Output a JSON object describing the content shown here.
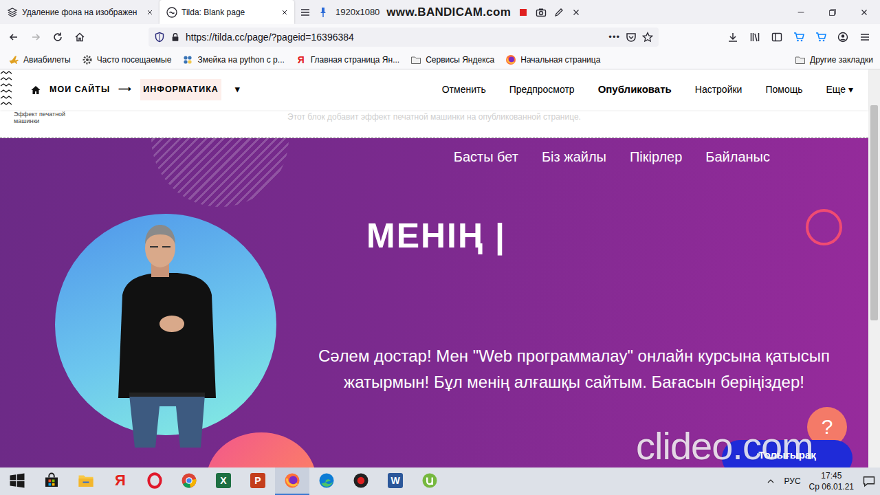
{
  "browser": {
    "tabs": [
      {
        "label": "Удаление фона на изображен",
        "selected": false
      },
      {
        "label": "Tilda: Blank page",
        "selected": true
      }
    ],
    "recorder": {
      "resolution": "1920x1080",
      "brand": "www.BANDICAM.com"
    },
    "history": {
      "back_enabled": true,
      "forward_enabled": false
    },
    "address": {
      "url": "https://tilda.cc/page/?pageid=16396384",
      "more": "•••"
    },
    "bookmarks": [
      {
        "label": "Авиабилеты",
        "kind": "plane"
      },
      {
        "label": "Часто посещаемые",
        "kind": "gear"
      },
      {
        "label": "Змейка на python с р...",
        "kind": "python"
      },
      {
        "label": "Главная страница Ян...",
        "kind": "glyph",
        "glyph": "Я"
      },
      {
        "label": "Сервисы Яндекса",
        "kind": "folder"
      },
      {
        "label": "Начальная страница",
        "kind": "firefox"
      }
    ],
    "other_bookmarks": "Другие закладки",
    "scrollbar": {
      "offset": 0.09,
      "share": 0.54
    }
  },
  "tilda": {
    "breadcrumb": [
      "МОИ САЙТЫ",
      "ИНФОРМАТИКА"
    ],
    "separator": "⟶",
    "dropdown": "▾",
    "menu": [
      {
        "label": "Отменить",
        "kind": "action"
      },
      {
        "label": "Предпросмотр",
        "kind": "action"
      },
      {
        "label": "Опубликовать",
        "kind": "publish"
      },
      {
        "label": "Настройки",
        "kind": "action"
      },
      {
        "label": "Помощь",
        "kind": "action"
      }
    ],
    "more": "Еще",
    "block_label": "Эффект печатной машинки",
    "block_note": "Этот блок добавит эффект печатной машинки на опубликованной странице."
  },
  "hero": {
    "nav": [
      "Басты бет",
      "Біз жайлы",
      "Пікірлер",
      "Байланыс"
    ],
    "title": "МЕНІҢ |",
    "text": "Сәлем достар! Мен \"Web программалау\" онлайн курсына қатысып жатырмын! Бұл менің алғашқы сайтым. Бағасын беріңіздер!",
    "button": "Толығырақ",
    "help": "?"
  },
  "watermark": "clideo.com",
  "taskbar": {
    "apps": [
      {
        "kind": "windows",
        "selected": false
      },
      {
        "kind": "store",
        "selected": false
      },
      {
        "kind": "explorer",
        "selected": false
      },
      {
        "kind": "yandex",
        "glyph": "Я",
        "selected": false
      },
      {
        "kind": "opera",
        "selected": false
      },
      {
        "kind": "chrome",
        "selected": false
      },
      {
        "kind": "excel",
        "glyph": "X",
        "selected": false
      },
      {
        "kind": "powerpoint",
        "glyph": "P",
        "selected": false
      },
      {
        "kind": "firefox",
        "selected": true
      },
      {
        "kind": "edge",
        "selected": false
      },
      {
        "kind": "record",
        "selected": false
      },
      {
        "kind": "word",
        "glyph": "W",
        "selected": false
      },
      {
        "kind": "utorrent",
        "selected": false
      }
    ],
    "language": "РУС",
    "time": "17:45",
    "date": "Ср 06.01.21"
  }
}
